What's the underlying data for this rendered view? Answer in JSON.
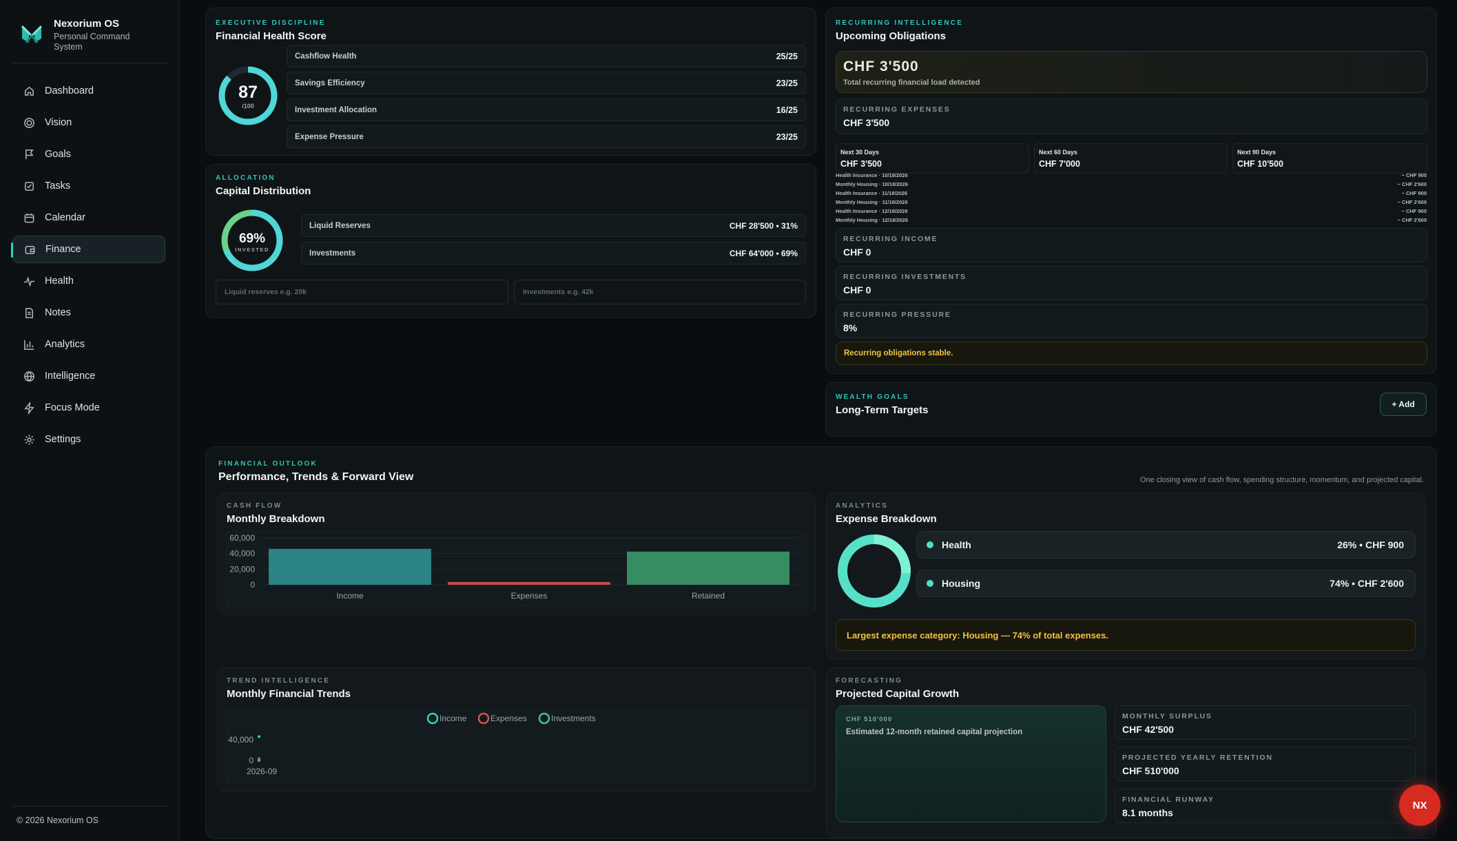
{
  "app": {
    "name": "Nexorium OS",
    "subtitle": "Personal Command System",
    "footer": "© 2026 Nexorium OS"
  },
  "nav": [
    {
      "label": "Dashboard",
      "icon": "home-icon"
    },
    {
      "label": "Vision",
      "icon": "target-icon"
    },
    {
      "label": "Goals",
      "icon": "flag-icon"
    },
    {
      "label": "Tasks",
      "icon": "checkbox-icon"
    },
    {
      "label": "Calendar",
      "icon": "calendar-icon"
    },
    {
      "label": "Finance",
      "icon": "wallet-icon",
      "active": true
    },
    {
      "label": "Health",
      "icon": "pulse-icon"
    },
    {
      "label": "Notes",
      "icon": "document-icon"
    },
    {
      "label": "Analytics",
      "icon": "bar-chart-icon"
    },
    {
      "label": "Intelligence",
      "icon": "globe-icon"
    },
    {
      "label": "Focus Mode",
      "icon": "bolt-icon"
    },
    {
      "label": "Settings",
      "icon": "gear-icon"
    }
  ],
  "health_score": {
    "kicker": "EXECUTIVE DISCIPLINE",
    "title": "Financial Health Score",
    "score": "87",
    "score_max": "/100",
    "score_fraction": 0.87,
    "rows": [
      {
        "label": "Cashflow Health",
        "value": "25/25"
      },
      {
        "label": "Savings Efficiency",
        "value": "23/25"
      },
      {
        "label": "Investment Allocation",
        "value": "16/25"
      },
      {
        "label": "Expense Pressure",
        "value": "23/25"
      }
    ]
  },
  "allocation": {
    "kicker": "ALLOCATION",
    "title": "Capital Distribution",
    "percent": "69%",
    "percent_label": "INVESTED",
    "invested_fraction": 0.69,
    "rows": [
      {
        "label": "Liquid Reserves",
        "value": "CHF 28'500 • 31%"
      },
      {
        "label": "Investments",
        "value": "CHF 64'000 • 69%"
      }
    ],
    "liquid_placeholder": "Liquid reserves e.g. 20k",
    "investments_placeholder": "Investments e.g. 42k"
  },
  "obligations": {
    "kicker": "RECURRING INTELLIGENCE",
    "title": "Upcoming Obligations",
    "total": "CHF 3'500",
    "total_sub": "Total recurring financial load detected",
    "expenses_label": "RECURRING EXPENSES",
    "expenses_value": "CHF 3'500",
    "windows": [
      {
        "label": "Next 30 Days",
        "value": "CHF 3'500"
      },
      {
        "label": "Next 60 Days",
        "value": "CHF 7'000"
      },
      {
        "label": "Next 90 Days",
        "value": "CHF 10'500"
      }
    ],
    "occurrences": [
      {
        "label": "Health Insurance · 10/18/2026",
        "amount": "− CHF 900"
      },
      {
        "label": "Monthly Housing · 10/18/2026",
        "amount": "− CHF 2'600"
      },
      {
        "label": "Health Insurance · 11/18/2026",
        "amount": "− CHF 900"
      },
      {
        "label": "Monthly Housing · 11/18/2026",
        "amount": "− CHF 2'600"
      },
      {
        "label": "Health Insurance · 12/18/2026",
        "amount": "− CHF 900"
      },
      {
        "label": "Monthly Housing · 12/18/2026",
        "amount": "− CHF 2'600"
      }
    ],
    "income_label": "RECURRING INCOME",
    "income_value": "CHF 0",
    "investments_label": "RECURRING INVESTMENTS",
    "investments_value": "CHF 0",
    "pressure_label": "RECURRING PRESSURE",
    "pressure_value": "8%",
    "status": "Recurring obligations stable."
  },
  "wealth_goals": {
    "kicker": "WEALTH GOALS",
    "title": "Long-Term Targets",
    "add_label": "+ Add"
  },
  "outlook": {
    "kicker": "FINANCIAL OUTLOOK",
    "title": "Performance, Trends & Forward View",
    "description": "One closing view of cash flow, spending structure, momentum, and projected capital."
  },
  "cashflow": {
    "kicker": "CASH FLOW",
    "title": "Monthly Breakdown"
  },
  "expense_breakdown": {
    "kicker": "ANALYTICS",
    "title": "Expense Breakdown",
    "items": [
      {
        "label": "Health",
        "value": "26% • CHF 900",
        "share": 0.26
      },
      {
        "label": "Housing",
        "value": "74% • CHF 2'600",
        "share": 0.74
      }
    ],
    "insight": "Largest expense category: Housing — 74% of total expenses."
  },
  "trends": {
    "kicker": "TREND INTELLIGENCE",
    "title": "Monthly Financial Trends"
  },
  "forecast": {
    "kicker": "FORECASTING",
    "title": "Projected Capital Growth",
    "projection_value": "CHF 510'000",
    "projection_sub": "Estimated 12-month retained capital projection",
    "surplus_label": "MONTHLY SURPLUS",
    "surplus_value": "CHF 42'500",
    "retention_label": "PROJECTED YEARLY RETENTION",
    "retention_value": "CHF 510'000",
    "runway_label": "FINANCIAL RUNWAY",
    "runway_value": "8.1 months"
  },
  "fab_label": "NX",
  "colors": {
    "accent": "#2fd3c1",
    "income": "#2f8f8f",
    "expenses": "#d9534f",
    "retained": "#3b9a6a",
    "warning": "#f2c23f"
  },
  "chart_data": [
    {
      "type": "bar",
      "title": "Monthly Breakdown",
      "categories": [
        "Income",
        "Expenses",
        "Retained"
      ],
      "values": [
        46000,
        3500,
        42500
      ],
      "yticks": [
        "60,000",
        "40,000",
        "20,000",
        "0"
      ],
      "ylim": [
        0,
        60000
      ],
      "grid": true
    },
    {
      "type": "line",
      "title": "Monthly Financial Trends",
      "x": [
        "2026-09"
      ],
      "series": [
        {
          "name": "Income",
          "values": [
            46000
          ]
        },
        {
          "name": "Expenses",
          "values": [
            3500
          ]
        },
        {
          "name": "Investments",
          "values": [
            0
          ]
        }
      ],
      "yticks": [
        "40,000",
        "0"
      ],
      "legend": "top-center"
    }
  ]
}
